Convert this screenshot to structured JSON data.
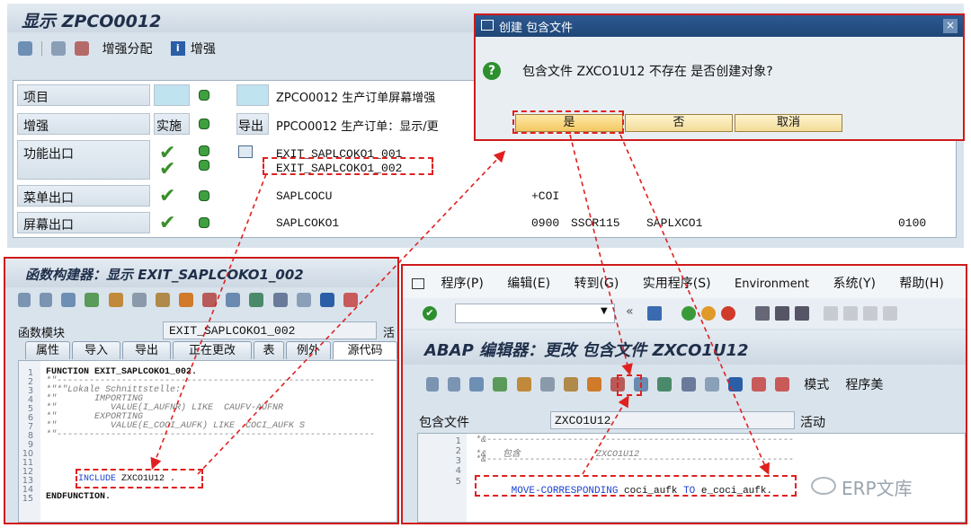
{
  "top": {
    "title": "显示 ZPCO0012",
    "toolbar": {
      "enh_assign": "增强分配",
      "enh": "增强",
      "enh_icon_letter": "i"
    },
    "rows": [
      {
        "label": "项目",
        "value": "ZPCO0012 生产订单屏幕增强"
      },
      {
        "label": "增强",
        "impl": "实施",
        "exit": "导出",
        "value": "PPCO0012 生产订单：显示/更"
      },
      {
        "label": "功能出口",
        "value1": "EXIT_SAPLCOKO1_001",
        "value2": "EXIT_SAPLCOKO1_002"
      },
      {
        "label": "菜单出口",
        "value": "SAPLCOCU",
        "value_b": "+COI"
      },
      {
        "label": "屏幕出口",
        "value": "SAPLCOKO1",
        "value_b": "0900",
        "value_c": "SSCR115",
        "value_d": "SAPLXCO1",
        "value_e": "0100"
      }
    ]
  },
  "dialog": {
    "title": "创建 包含文件",
    "close": "×",
    "message": "包含文件 ZXCO1U12 不存在 是否创建对象?",
    "yes": "是",
    "no": "否",
    "cancel": "取消"
  },
  "fb": {
    "title": "函数构建器：显示 EXIT_SAPLCOKO1_002",
    "module_label": "函数模块",
    "module_value": "EXIT_SAPLCOKO1_002",
    "status": "活动",
    "tabs": [
      "属性",
      "导入",
      "导出",
      "正在更改",
      "表",
      "例外",
      "源代码"
    ],
    "lines": [
      "1",
      "2",
      "3",
      "4",
      "5",
      "6",
      "7",
      "8",
      "9",
      "10",
      "11",
      "12",
      "13",
      "14",
      "15"
    ],
    "code": {
      "l1": "FUNCTION EXIT_SAPLCOKO1_002.",
      "l2": "*\"-----------------------------------------------------------",
      "l3": "*\"*\"Lokale Schnittstelle:",
      "l4": "*\"       IMPORTING",
      "l5": "*\"          VALUE(I_AUFNR) LIKE  CAUFV-AUFNR",
      "l6": "*\"       EXPORTING",
      "l7": "*\"          VALUE(E_COCI_AUFK) LIKE  COCI_AUFK S",
      "l8": "*\"-----------------------------------------------------------",
      "l11_kw": "INCLUDE",
      "l11_rest": " ZXCO1U12 .",
      "l14": "ENDFUNCTION."
    }
  },
  "editor": {
    "menu": [
      "程序(P)",
      "编辑(E)",
      "转到(G)",
      "实用程序(S)",
      "Environment",
      "系统(Y)",
      "帮助(H)"
    ],
    "title": "ABAP 编辑器：更改 包含文件 ZXCO1U12",
    "mode_label": "模式",
    "program_label": "程序美",
    "include_label": "包含文件",
    "include_value": "ZXCO1U12",
    "status": "活动",
    "lines": [
      "1",
      "2",
      "3",
      "4",
      "5"
    ],
    "code": {
      "l1": "*&---------------------------------------------------------",
      "l2": "*&   包含              ZXCO1U12",
      "l3": "*&---------------------------------------------------------",
      "l5_kw1": "MOVE-CORRESPONDING",
      "l5_mid": " coci_aufk ",
      "l5_kw2": "TO",
      "l5_end": " e_coci_aufk."
    }
  },
  "watermark": "ERP文库",
  "colors": {
    "red": "#e02020",
    "sap_blue": "#1f2f4a",
    "led_green": "#3fa03f"
  }
}
